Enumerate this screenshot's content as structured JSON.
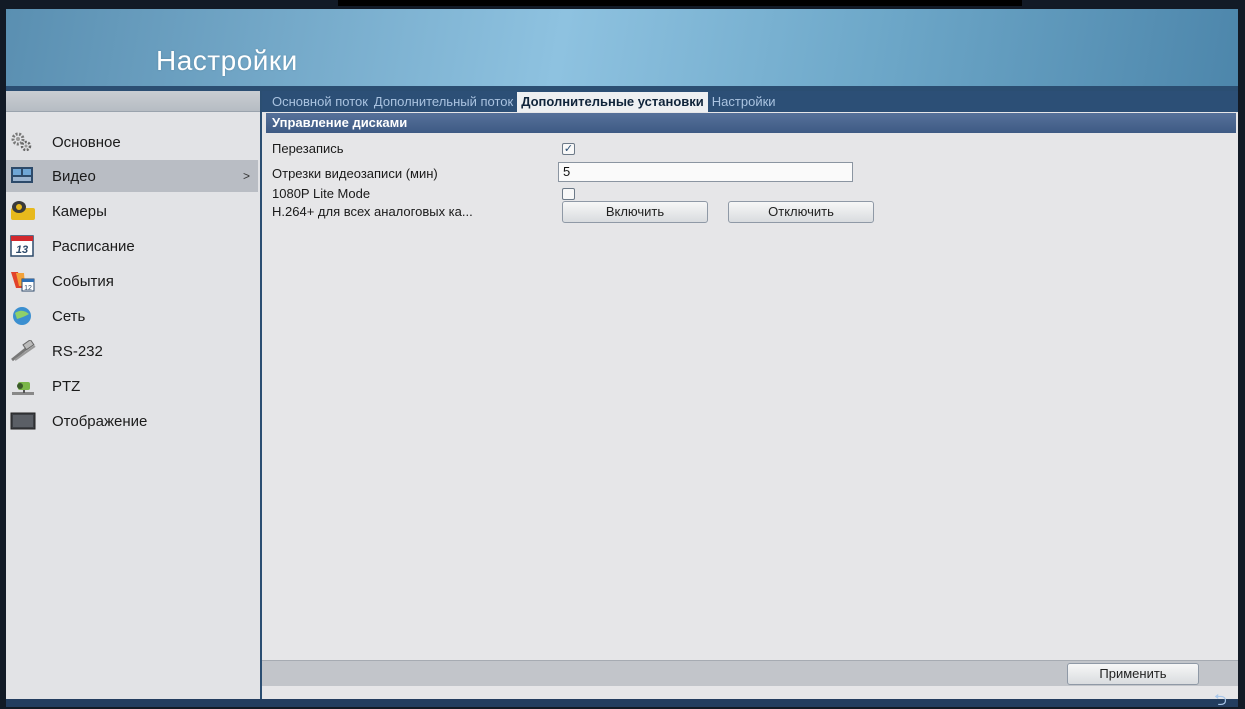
{
  "header": {
    "title": "Настройки"
  },
  "sidebar": {
    "items": [
      {
        "label": "Основное",
        "icon": "gear-icon"
      },
      {
        "label": "Видео",
        "icon": "video-icon",
        "active": true,
        "arrow": ">"
      },
      {
        "label": "Камеры",
        "icon": "camera-icon"
      },
      {
        "label": "Расписание",
        "icon": "calendar-icon",
        "icon_text": "13"
      },
      {
        "label": "События",
        "icon": "events-icon",
        "icon_text": "12"
      },
      {
        "label": "Сеть",
        "icon": "network-icon"
      },
      {
        "label": "RS-232",
        "icon": "rs232-icon"
      },
      {
        "label": "PTZ",
        "icon": "ptz-icon"
      },
      {
        "label": "Отображение",
        "icon": "display-icon"
      }
    ]
  },
  "tabs": [
    {
      "label": "Основной поток",
      "active": false
    },
    {
      "label": "Дополнительный поток",
      "active": false
    },
    {
      "label": "Дополнительные установки",
      "active": true
    },
    {
      "label": "Настройки",
      "active": false
    }
  ],
  "section": {
    "title": "Управление дисками"
  },
  "fields": {
    "overwrite": {
      "label": "Перезапись",
      "checked": true,
      "check_mark": "✓"
    },
    "segments": {
      "label": "Отрезки видеозаписи (мин)",
      "value": "5"
    },
    "lite_mode": {
      "label": "1080P Lite Mode",
      "checked": false
    },
    "h264": {
      "label": "H.264+ для всех аналоговых ка...",
      "enable_label": "Включить",
      "disable_label": "Отключить"
    }
  },
  "footer": {
    "apply_label": "Применить",
    "back_icon": "⮌"
  },
  "colors": {
    "accent": "#2c4f76",
    "section": "#46628c",
    "active_item": "#b9bdc4"
  }
}
